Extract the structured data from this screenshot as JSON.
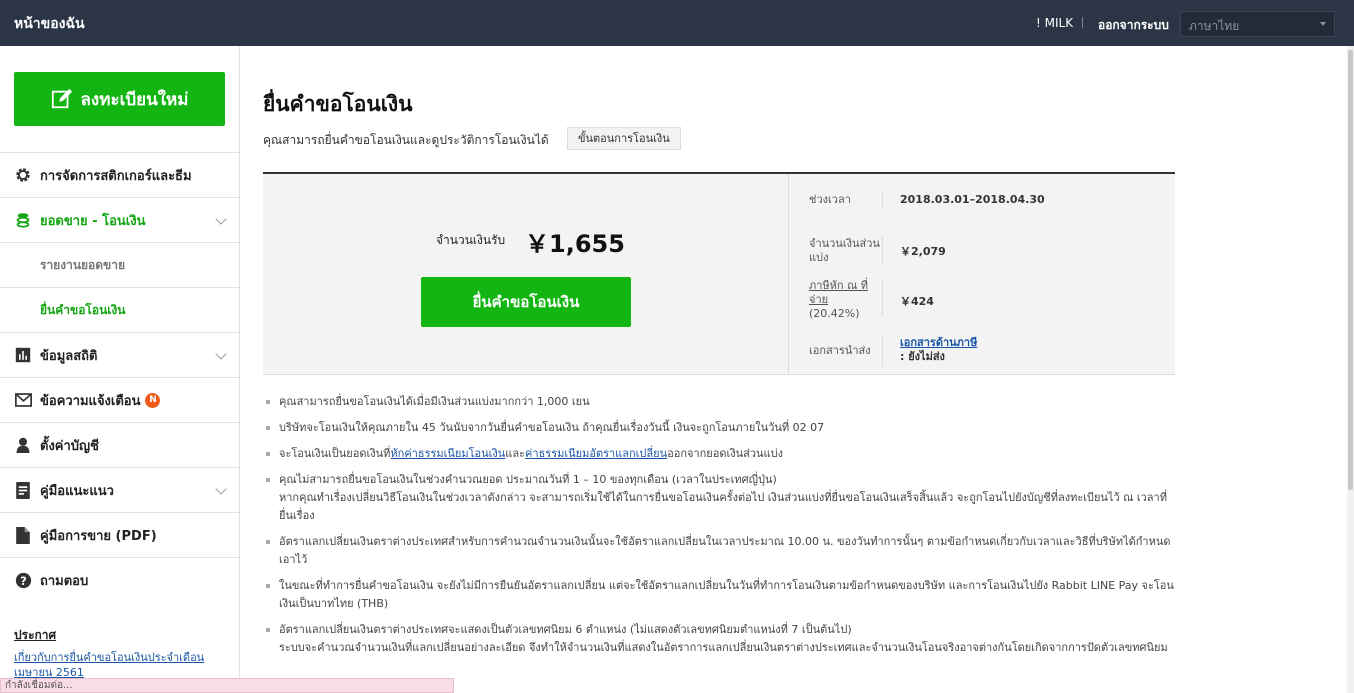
{
  "topbar": {
    "brand": "หน้าของฉัน",
    "user": "! MILK",
    "logout": "ออกจากระบบ",
    "language": "ภาษาไทย"
  },
  "sidebar": {
    "register_button": "ลงทะเบียนใหม่",
    "items": [
      {
        "label": "การจัดการสติกเกอร์และธีม",
        "icon": "gear-icon"
      },
      {
        "label": "ยอดขาย - โอนเงิน",
        "icon": "coins-icon"
      },
      {
        "label": "รายงานยอดขาย"
      },
      {
        "label": "ยื่นคำขอโอนเงิน"
      },
      {
        "label": "ข้อมูลสถิติ",
        "icon": "chart-icon"
      },
      {
        "label": "ข้อความแจ้งเตือน",
        "icon": "mail-icon",
        "badge": "N"
      },
      {
        "label": "ตั้งค่าบัญชี",
        "icon": "user-icon"
      },
      {
        "label": "คู่มือแนะแนว",
        "icon": "guide-icon"
      },
      {
        "label": "คู่มือการขาย (PDF)",
        "icon": "file-icon"
      },
      {
        "label": "ถามตอบ",
        "icon": "question-icon"
      }
    ],
    "notice_title": "ประกาศ",
    "notice_link": "เกี่ยวกับการยื่นคำขอโอนเงินประจำเดือนเมษายน 2561",
    "status": "กำลังเชื่อมต่อ..."
  },
  "main": {
    "title": "ยื่นคำขอโอนเงิน",
    "description": "คุณสามารถยื่นคำขอโอนเงินและดูประวัติการโอนเงินได้",
    "process_button": "ขั้นตอนการโอนเงิน",
    "receive_label": "จำนวนเงินรับ",
    "receive_amount": "￥1,655",
    "request_button": "ยื่นคำขอโอนเงิน",
    "info": {
      "period_label": "ช่วงเวลา",
      "period_value": "2018.03.01–2018.04.30",
      "share_label": "จำนวนเงินส่วนแบ่ง",
      "share_value": "￥2,079",
      "tax_label": "ภาษีหัก ณ ที่จ่าย",
      "tax_rate": "(20.42%)",
      "tax_value": "￥424",
      "docs_label": "เอกสารนำส่ง",
      "docs_link": "เอกสารด้านภาษี",
      "docs_status": ": ยังไม่ส่ง"
    },
    "notes": {
      "n1": "คุณสามารถยื่นขอโอนเงินได้เมื่อมีเงินส่วนแบ่งมากกว่า 1,000 เยน",
      "n2": "บริษัทจะโอนเงินให้คุณภายใน 45 วันนับจากวันยื่นคำขอโอนเงิน ถ้าคุณยื่นเรื่องวันนี้ เงินจะถูกโอนภายในวันที่ 02 07",
      "n3_a": "จะโอนเงินเป็นยอดเงินที่",
      "n3_link1": "หักค่าธรรมเนียมโอนเงิน",
      "n3_b": "และ",
      "n3_link2": "ค่าธรรมเนียมอัตราแลกเปลี่ยน",
      "n3_c": "ออกจากยอดเงินส่วนแบ่ง",
      "n4_line1": "คุณไม่สามารถยื่นขอโอนเงินในช่วงคำนวณยอด ประมาณวันที่ 1 – 10 ของทุกเดือน (เวลาในประเทศญี่ปุ่น)",
      "n4_line2": "หากคุณทำเรื่องเปลี่ยนวิธีโอนเงินในช่วงเวลาดังกล่าว จะสามารถเริ่มใช้ได้ในการยื่นขอโอนเงินครั้งต่อไป เงินส่วนแบ่งที่ยื่นขอโอนเงินเสร็จสิ้นแล้ว จะถูกโอนไปยังบัญชีที่ลงทะเบียนไว้ ณ เวลาที่ยื่นเรื่อง",
      "n5": "อัตราแลกเปลี่ยนเงินตราต่างประเทศสำหรับการคำนวณจำนวนเงินนั้นจะใช้อัตราแลกเปลี่ยนในเวลาประมาณ 10.00 น. ของวันทำการนั้นๆ ตามข้อกำหนดเกี่ยวกับเวลาและวิธีที่บริษัทได้กำหนดเอาไว้",
      "n6": "ในขณะที่ทำการยื่นคำขอโอนเงิน จะยังไม่มีการยืนยันอัตราแลกเปลี่ยน แต่จะใช้อัตราแลกเปลี่ยนในวันที่ทำการโอนเงินตามข้อกำหนดของบริษัท และการโอนเงินไปยัง Rabbit LINE Pay จะโอนเงินเป็นบาทไทย (THB)",
      "n7_line1": "อัตราแลกเปลี่ยนเงินตราต่างประเทศจะแสดงเป็นตัวเลขทศนิยม 6 ตำแหน่ง (ไม่แสดงตัวเลขทศนิยมตำแหน่งที่ 7 เป็นต้นไป)",
      "n7_line2": "ระบบจะคำนวณจำนวนเงินที่แลกเปลี่ยนอย่างละเอียด จึงทำให้จำนวนเงินที่แสดงในอัตราการแลกเปลี่ยนเงินตราต่างประเทศและจำนวนเงินโอนจริงอาจต่างกันโดยเกิดจากการปัดตัวเลขทศนิยม"
    }
  },
  "colors": {
    "topbar": "#2b3545",
    "accent_green": "#13b513",
    "link_blue": "#1a56a8",
    "badge_orange": "#f25a1c"
  }
}
